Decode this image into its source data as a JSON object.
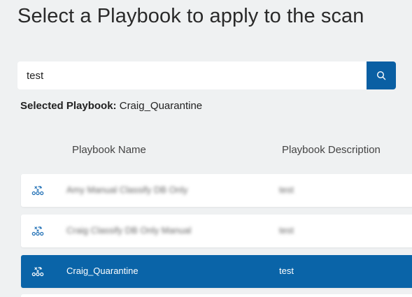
{
  "page": {
    "title": "Select a Playbook to apply to the scan"
  },
  "search": {
    "value": "test",
    "button_icon": "search-icon"
  },
  "selection": {
    "label": "Selected Playbook:",
    "value": "Craig_Quarantine"
  },
  "table": {
    "columns": [
      "Playbook Name",
      "Playbook Description"
    ],
    "rows": [
      {
        "icon": "playbook-icon",
        "name": "Amy Manual Classify DB Only",
        "description": "test",
        "selected": false,
        "blurred": true
      },
      {
        "icon": "playbook-icon",
        "name": "Craig Classify DB Only Manual",
        "description": "test",
        "selected": false,
        "blurred": true
      },
      {
        "icon": "playbook-icon",
        "name": "Craig_Quarantine",
        "description": "test",
        "selected": true,
        "blurred": false
      }
    ]
  },
  "colors": {
    "accent": "#0a64a8",
    "search_button": "#0a5fa3",
    "background": "#eff1f2",
    "icon_blue": "#1f6fb5"
  }
}
